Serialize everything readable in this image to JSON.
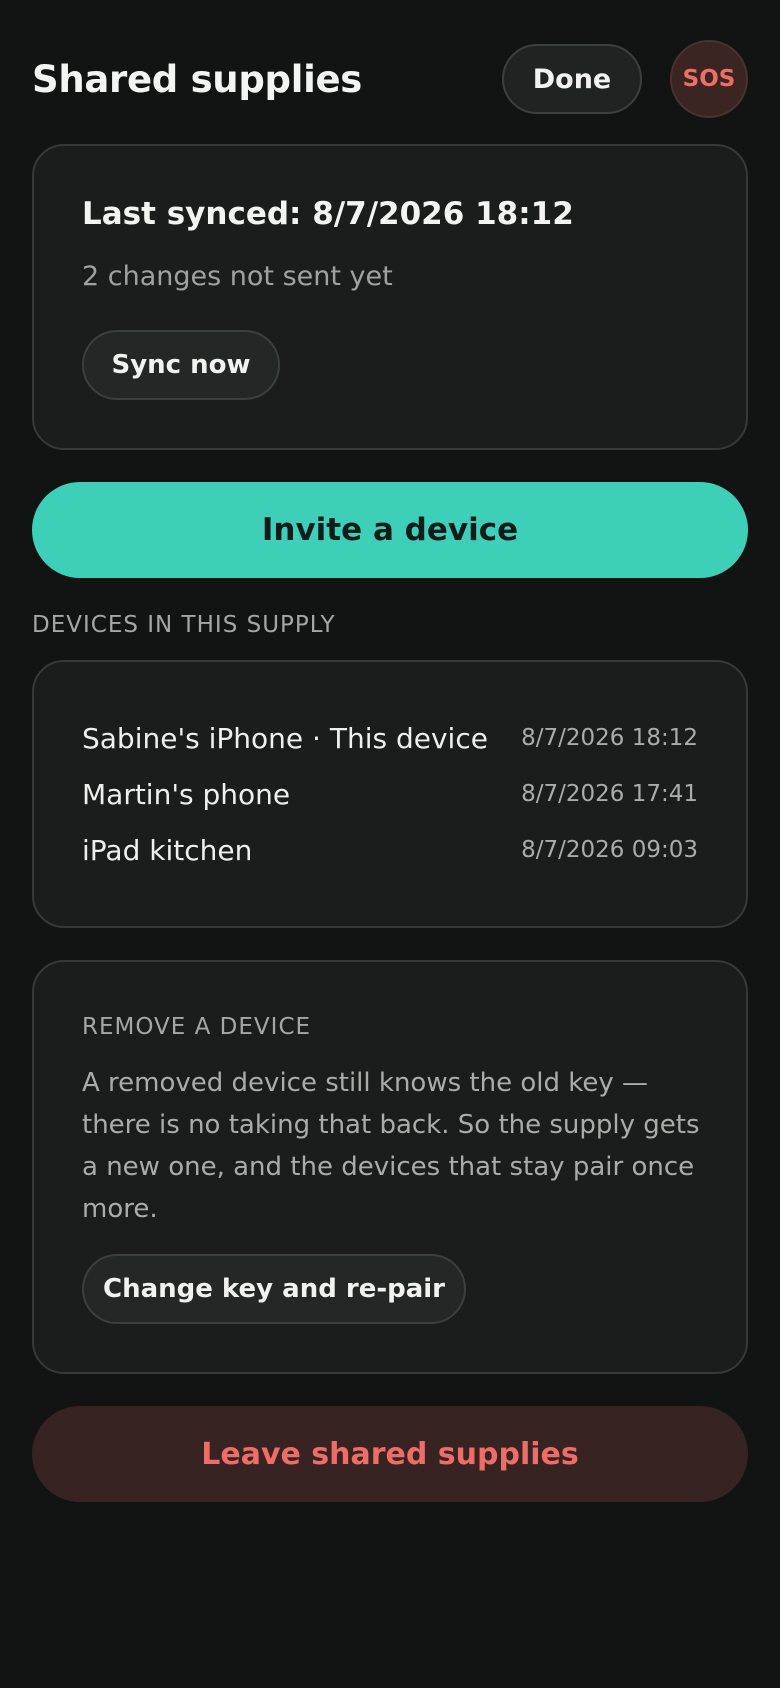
{
  "header": {
    "title": "Shared supplies",
    "done_label": "Done",
    "sos_label": "SOS"
  },
  "sync": {
    "last_synced": "Last synced: 8/7/2026 18:12",
    "pending": "2 changes not sent yet",
    "sync_now_label": "Sync now"
  },
  "invite_label": "Invite a device",
  "devices": {
    "section_label": "DEVICES IN THIS SUPPLY",
    "items": [
      {
        "name": "Sabine's iPhone · This device",
        "time": "8/7/2026 18:12"
      },
      {
        "name": "Martin's phone",
        "time": "8/7/2026 17:41"
      },
      {
        "name": "iPad kitchen",
        "time": "8/7/2026 09:03"
      }
    ]
  },
  "remove": {
    "label": "REMOVE A DEVICE",
    "description": "A removed device still knows the old key — there is no taking that back. So the supply gets a new one, and the devices that stay pair once more.",
    "button_label": "Change key and re-pair"
  },
  "leave_label": "Leave shared supplies",
  "colors": {
    "background": "#121414",
    "accent": "#3ecfb8",
    "danger": "#ee6d66",
    "danger_bg": "#362322"
  }
}
